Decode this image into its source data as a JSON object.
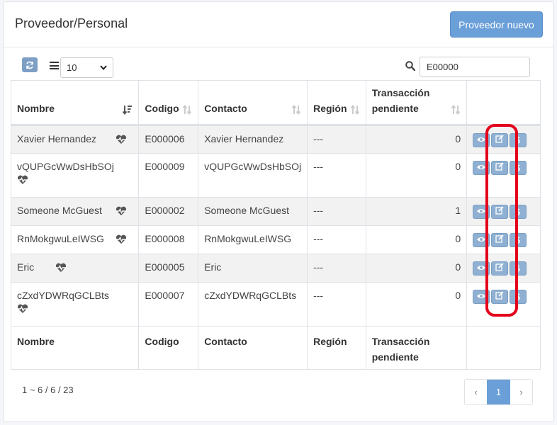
{
  "header": {
    "title": "Proveedor/Personal",
    "new_button": "Proveedor nuevo"
  },
  "toolbar": {
    "page_size": "10",
    "search_value": "E00000"
  },
  "table": {
    "columns": [
      "Nombre",
      "Codigo",
      "Contacto",
      "Región",
      "Transacción pendiente"
    ],
    "rows": [
      {
        "nombre": "Xavier Hernandez",
        "codigo": "E000006",
        "contacto": "Xavier Hernandez",
        "region": "---",
        "pendiente": "0"
      },
      {
        "nombre": "vQUPGcWwDsHbSOj",
        "codigo": "E000009",
        "contacto": "vQUPGcWwDsHbSOj",
        "region": "---",
        "pendiente": "0"
      },
      {
        "nombre": "Someone McGuest",
        "codigo": "E000002",
        "contacto": "Someone McGuest",
        "region": "---",
        "pendiente": "1"
      },
      {
        "nombre": "RnMokgwuLeIWSG",
        "codigo": "E000008",
        "contacto": "RnMokgwuLeIWSG",
        "region": "---",
        "pendiente": "0"
      },
      {
        "nombre": "Eric",
        "codigo": "E000005",
        "contacto": "Eric",
        "region": "---",
        "pendiente": "0"
      },
      {
        "nombre": "cZxdYDWRqGCLBts",
        "codigo": "E000007",
        "contacto": "cZxdYDWRqGCLBts",
        "region": "---",
        "pendiente": "0"
      }
    ],
    "row_icons": [
      "heart-pulse-icon",
      "eye-icon",
      "edit-icon",
      "dollar-icon"
    ]
  },
  "footer": {
    "range_info": "1 ~ 6 / 6 / 23",
    "pager": {
      "prev": "‹",
      "current": "1",
      "next": "›"
    }
  },
  "colors": {
    "primary": "#6a9fd8",
    "action_button": "#8fb0d2",
    "highlight": "#e4001b"
  }
}
